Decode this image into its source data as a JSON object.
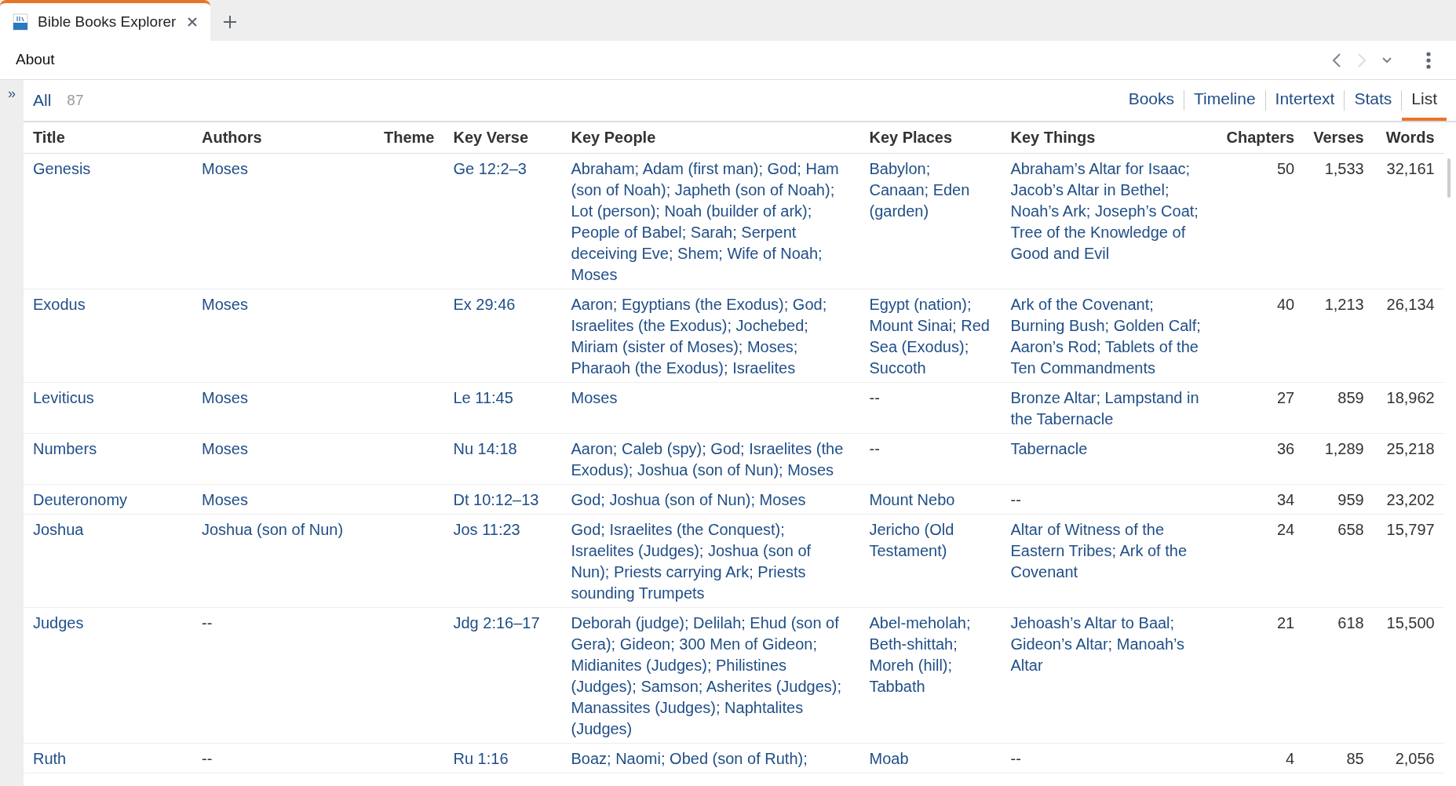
{
  "tab": {
    "title": "Bible Books Explorer"
  },
  "toolbar": {
    "title": "About"
  },
  "sidebar_toggle": "»",
  "nav": {
    "back_disabled": false,
    "forward_disabled": true
  },
  "filter": {
    "label": "All",
    "count": "87"
  },
  "views": [
    {
      "label": "Books",
      "selected": false
    },
    {
      "label": "Timeline",
      "selected": false
    },
    {
      "label": "Intertext",
      "selected": false
    },
    {
      "label": "Stats",
      "selected": false
    },
    {
      "label": "List",
      "selected": true
    }
  ],
  "table": {
    "columns": [
      "Title",
      "Authors",
      "Theme",
      "Key Verse",
      "Key People",
      "Key Places",
      "Key Things",
      "Chapters",
      "Verses",
      "Words"
    ],
    "rows": [
      [
        "Genesis",
        "Moses",
        "",
        "Ge 12:2–3",
        "Abraham; Adam (first man); God; Ham (son of Noah); Japheth (son of Noah); Lot (person); Noah (builder of ark); People of Babel; Sarah; Serpent deceiving Eve; Shem; Wife of Noah; Moses",
        "Babylon; Canaan; Eden (garden)",
        "Abraham’s Altar for Isaac; Jacob’s Altar in Bethel; Noah’s Ark; Joseph’s Coat; Tree of the Knowledge of Good and Evil",
        "50",
        "1,533",
        "32,161"
      ],
      [
        "Exodus",
        "Moses",
        "",
        "Ex 29:46",
        "Aaron; Egyptians (the Exodus); God; Israelites (the Exodus); Jochebed; Miriam (sister of Moses); Moses; Pharaoh (the Exodus); Israelites",
        "Egypt (nation); Mount Sinai; Red Sea (Exodus); Succoth",
        "Ark of the Covenant; Burning Bush; Golden Calf; Aaron’s Rod; Tablets of the Ten Commandments",
        "40",
        "1,213",
        "26,134"
      ],
      [
        "Leviticus",
        "Moses",
        "",
        "Le 11:45",
        "Moses",
        "--",
        "Bronze Altar; Lampstand in the Tabernacle",
        "27",
        "859",
        "18,962"
      ],
      [
        "Numbers",
        "Moses",
        "",
        "Nu 14:18",
        "Aaron; Caleb (spy); God; Israelites (the Exodus); Joshua (son of Nun); Moses",
        "--",
        "Tabernacle",
        "36",
        "1,289",
        "25,218"
      ],
      [
        "Deuteronomy",
        "Moses",
        "",
        "Dt 10:12–13",
        "God; Joshua (son of Nun); Moses",
        "Mount Nebo",
        "--",
        "34",
        "959",
        "23,202"
      ],
      [
        "Joshua",
        "Joshua (son of Nun)",
        "",
        "Jos 11:23",
        "God; Israelites (the Conquest); Israelites (Judges); Joshua (son of Nun); Priests carrying Ark; Priests sounding Trumpets",
        "Jericho (Old Testament)",
        "Altar of Witness of the Eastern Tribes; Ark of the Covenant",
        "24",
        "658",
        "15,797"
      ],
      [
        "Judges",
        "--",
        "",
        "Jdg 2:16–17",
        "Deborah (judge); Delilah; Ehud (son of Gera); Gideon; 300 Men of Gideon; Midianites (Judges); Philistines (Judges); Samson; Asherites (Judges); Manassites (Judges); Naphtalites (Judges)",
        "Abel-meholah; Beth-shittah; Moreh (hill); Tabbath",
        "Jehoash’s Altar to Baal; Gideon’s Altar; Manoah’s Altar",
        "21",
        "618",
        "15,500"
      ],
      [
        "Ruth",
        "--",
        "",
        "Ru 1:16",
        "Boaz; Naomi; Obed (son of Ruth);",
        "Moab",
        "--",
        "4",
        "85",
        "2,056"
      ]
    ]
  }
}
